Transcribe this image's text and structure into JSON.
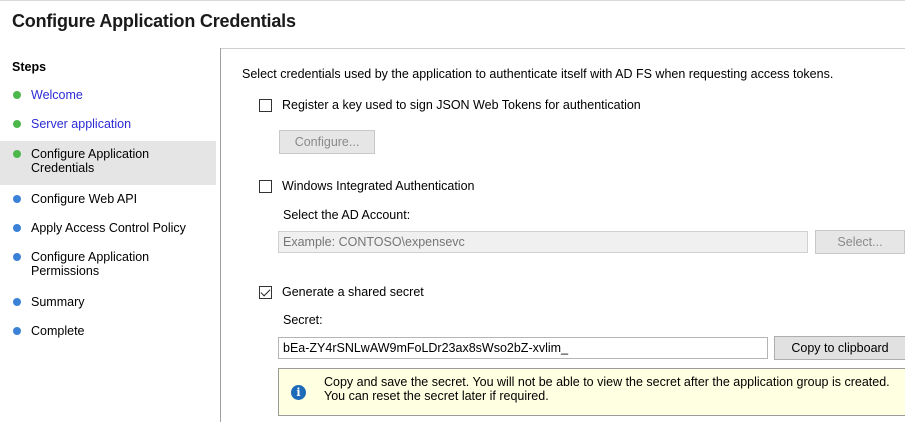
{
  "header": {
    "title": "Configure Application Credentials"
  },
  "sidebar": {
    "title": "Steps",
    "items": [
      {
        "label": "Welcome",
        "status": "done",
        "link": true
      },
      {
        "label": "Server application",
        "status": "done",
        "link": true
      },
      {
        "label": "Configure Application Credentials",
        "status": "current",
        "link": false
      },
      {
        "label": "Configure Web API",
        "status": "pending",
        "link": false
      },
      {
        "label": "Apply Access Control Policy",
        "status": "pending",
        "link": false
      },
      {
        "label": "Configure Application Permissions",
        "status": "pending",
        "link": false
      },
      {
        "label": "Summary",
        "status": "pending",
        "link": false
      },
      {
        "label": "Complete",
        "status": "pending",
        "link": false
      }
    ]
  },
  "main": {
    "description": "Select credentials used by the application to authenticate itself with AD FS when requesting access tokens.",
    "register_key": {
      "label": "Register a key used to sign JSON Web Tokens for authentication",
      "checked": false
    },
    "configure_button": "Configure...",
    "windows_auth": {
      "label": "Windows Integrated Authentication",
      "checked": false
    },
    "ad_account_label": "Select the AD Account:",
    "ad_account_placeholder": "Example: CONTOSO\\expensevc",
    "select_button": "Select...",
    "shared_secret": {
      "label": "Generate a shared secret",
      "checked": true
    },
    "secret_label": "Secret:",
    "secret_value": "bEa-ZY4rSNLwAW9mFoLDr23ax8sWso2bZ-xvlim_",
    "copy_button": "Copy to clipboard",
    "info_text": "Copy and save the secret.  You will not be able to view the secret after the application group is created.  You can reset the secret later if required."
  },
  "colors": {
    "done_dot": "#4cb84c",
    "pending_dot": "#3b82d6",
    "link": "#2b2bd6",
    "info_bg": "#ffffe1"
  },
  "icons": {
    "info": "info-icon"
  }
}
